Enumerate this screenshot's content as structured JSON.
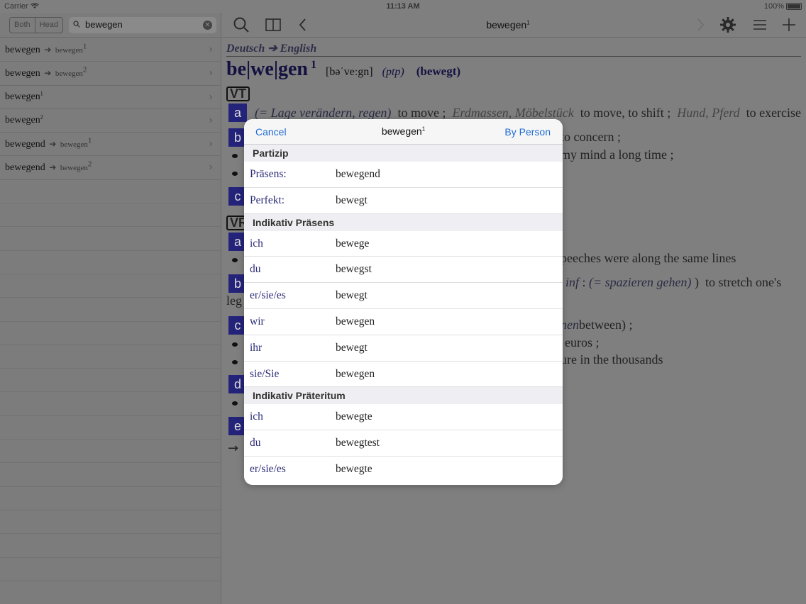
{
  "status": {
    "carrier": "Carrier",
    "time": "11:13 AM",
    "battery": "100%"
  },
  "left": {
    "seg_both": "Both",
    "seg_head": "Head",
    "search_value": "bewegen",
    "items": [
      {
        "word": "bewegen",
        "target": "bewegen",
        "target_sup": "1",
        "word_sup": ""
      },
      {
        "word": "bewegen",
        "target": "bewegen",
        "target_sup": "2",
        "word_sup": ""
      },
      {
        "word": "bewegen",
        "target": "",
        "target_sup": "",
        "word_sup": "1"
      },
      {
        "word": "bewegen",
        "target": "",
        "target_sup": "",
        "word_sup": "2"
      },
      {
        "word": "bewegend",
        "target": "bewegen",
        "target_sup": "1",
        "word_sup": ""
      },
      {
        "word": "bewegend",
        "target": "bewegen",
        "target_sup": "2",
        "word_sup": ""
      }
    ]
  },
  "toolbar": {
    "title": "bewegen",
    "title_sup": "1"
  },
  "entry": {
    "lang": "Deutsch ➔ English",
    "headword": "be|we|gen",
    "headword_num": "1",
    "pron": "[bəˈveːgn]",
    "ptp": "(ptp)",
    "form": "(bewegt)",
    "vt": "VT",
    "vr": "VR",
    "sense_a": "a",
    "sense_b": "b",
    "sense_c": "c",
    "sense_d": "d",
    "sense_e": "e",
    "a_note": "(= Lage verändern, regen)",
    "a_gloss1": "to move ;",
    "a_ital1": "Erdmassen, Möbelstück",
    "a_gloss2": "to move, to shift ;",
    "a_ital2": "Hund, Pferd",
    "a_gloss3": "to exercise",
    "frag1": "to concern ;",
    "frag2": "my mind a long time ;",
    "frag3": "peeches were along the same lines",
    "frag4_i": "inf",
    "frag4_colon": ":",
    "frag4_note": "(= spazieren gehen)",
    "frag4_paren": ")",
    "frag4": "to stretch one's",
    "frag5": "leg",
    "frag6_i": "nen",
    "frag6": "between) ;",
    "frag7": "euros ;",
    "frag8": "ure in the thousands",
    "arrow": "→"
  },
  "dialog": {
    "cancel": "Cancel",
    "title": "bewegen",
    "title_sup": "1",
    "by_person": "By Person",
    "sections": [
      {
        "name": "Partizip",
        "rows": [
          {
            "k": "Präsens:",
            "v": "bewegend"
          },
          {
            "k": "Perfekt:",
            "v": "bewegt"
          }
        ]
      },
      {
        "name": "Indikativ Präsens",
        "rows": [
          {
            "k": "ich",
            "v": "bewege"
          },
          {
            "k": "du",
            "v": "bewegst"
          },
          {
            "k": "er/sie/es",
            "v": "bewegt"
          },
          {
            "k": "wir",
            "v": "bewegen"
          },
          {
            "k": "ihr",
            "v": "bewegt"
          },
          {
            "k": "sie/Sie",
            "v": "bewegen"
          }
        ]
      },
      {
        "name": "Indikativ Präteritum",
        "rows": [
          {
            "k": "ich",
            "v": "bewegte"
          },
          {
            "k": "du",
            "v": "bewegtest"
          },
          {
            "k": "er/sie/es",
            "v": "bewegte"
          }
        ]
      }
    ]
  }
}
